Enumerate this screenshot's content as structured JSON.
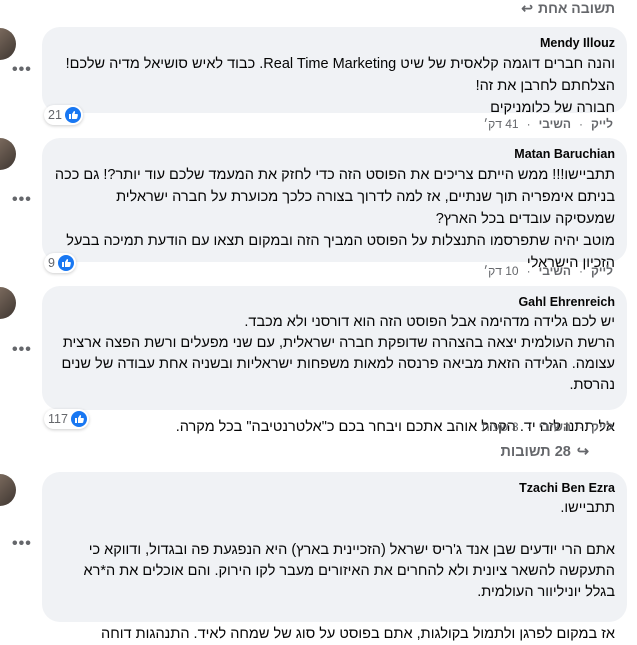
{
  "top_reply": {
    "label": "תשובה אחת"
  },
  "comments": [
    {
      "author": "Mendy Illouz",
      "text": "והנה חברים דוגמה קלאסית של שיט Real Time Marketing. כבוד לאיש סושיאל מדיה שלכם!\nהצלחתם לחרבן את זה!\nחבורה של כלומניקים",
      "reactions": "21",
      "like": "לייק",
      "reply": "השיבי",
      "time": "41 דק׳"
    },
    {
      "author": "Matan Baruchian",
      "text": "תתביישו!!! ממש הייתם צריכים את הפוסט הזה כדי לחזק את המעמד שלכם עוד יותר?! גם ככה בניתם אימפריה תוך שנתיים, אז למה לדרוך בצורה כלכך מכוערת על חברה ישראלית שמעסיקה עובדים בכל הארץ?\nמוטב יהיה שתפרסמו התנצלות על הפוסט המביך הזה ובמקום תצאו עם הודעת תמיכה בבעל הזכיון הישראלי",
      "reactions": "9",
      "like": "לייק",
      "reply": "השיבי",
      "time": "10 דק׳"
    },
    {
      "author": "Gahl Ehrenreich",
      "text": "יש לכם גלידה מדהימה אבל הפוסט הזה הוא דורסני ולא מכבד.\nהרשת העולמית יצאה בהצהרה שדופקת חברה ישראלית, עם שני מפעלים ורשת הפצה ארצית עצומה. הגלידה הזאת מביאה פרנסה למאות משפחות ישראליות ובשניה אחת עבודה של שנים נהרסת.\n\nאל תתנו לזה יד. הקהל אוהב אתכם ויבחר בכם כ\"אלטרנטיבה\" בכל מקרה.",
      "reactions": "117",
      "like": "לייק",
      "reply": "השיבי",
      "time": "3 שעות"
    },
    {
      "author": "Tzachi Ben Ezra",
      "text": "תתביישו.\n\nאתם הרי יודעים שבן אנד ג'ריס ישראל (הזכיינית בארץ) היא הנפגעת פה ובגדול, ודווקא כי התעקשה להשאר ציונית ולא להחרים את האיזורים מעבר לקו הירוק. והם אוכלים את ה*רא בגלל יוניליוור העולמית.\n\nאז במקום לפרגן ולתמול בקולגות, אתם בפוסט על סוג של שמחה לאיד. התנהגות דוחה"
    }
  ],
  "replies_count": {
    "label": "28 תשובות"
  },
  "icons": {
    "like": "thumbs-up-icon",
    "more": "more-options-icon",
    "reply_arrow": "reply-arrow-icon"
  },
  "colors": {
    "like_blue": "#1877f2",
    "bubble_bg": "#f0f2f5",
    "meta_gray": "#65676b"
  }
}
